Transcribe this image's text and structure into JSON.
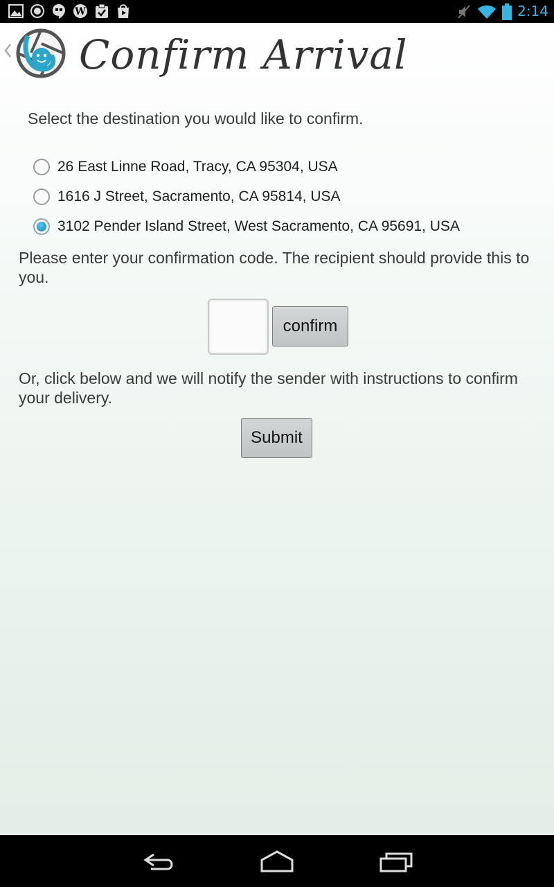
{
  "status_bar": {
    "time": "2:14",
    "left_icons": [
      "gallery-icon",
      "record-icon",
      "hangouts-icon",
      "wordpress-icon",
      "tasks-icon",
      "play-store-icon"
    ],
    "right_icons": [
      "muted-icon",
      "wifi-icon",
      "battery-icon"
    ],
    "accent_color": "#33b5e5"
  },
  "header": {
    "title": "Confirm Arrival",
    "logo_icon": "camera-shutter-face-logo",
    "back_icon": "chevron-left-icon"
  },
  "destination": {
    "prompt": "Select the destination you would like to confirm.",
    "options": [
      {
        "label": "26 East Linne Road, Tracy, CA 95304, USA",
        "checked": false
      },
      {
        "label": "1616 J Street, Sacramento, CA 95814, USA",
        "checked": false
      },
      {
        "label": "3102 Pender Island Street, West Sacramento, CA 95691, USA",
        "checked": true
      }
    ]
  },
  "confirmation": {
    "instructions": "Please enter your confirmation code. The recipient should provide this to you.",
    "code_value": "",
    "confirm_label": "confirm"
  },
  "notify": {
    "instructions": "Or, click below and we will notify the sender with instructions to confirm your delivery.",
    "submit_label": "Submit"
  },
  "nav_bar": {
    "buttons": [
      "back-icon",
      "home-icon",
      "recent-apps-icon"
    ]
  }
}
